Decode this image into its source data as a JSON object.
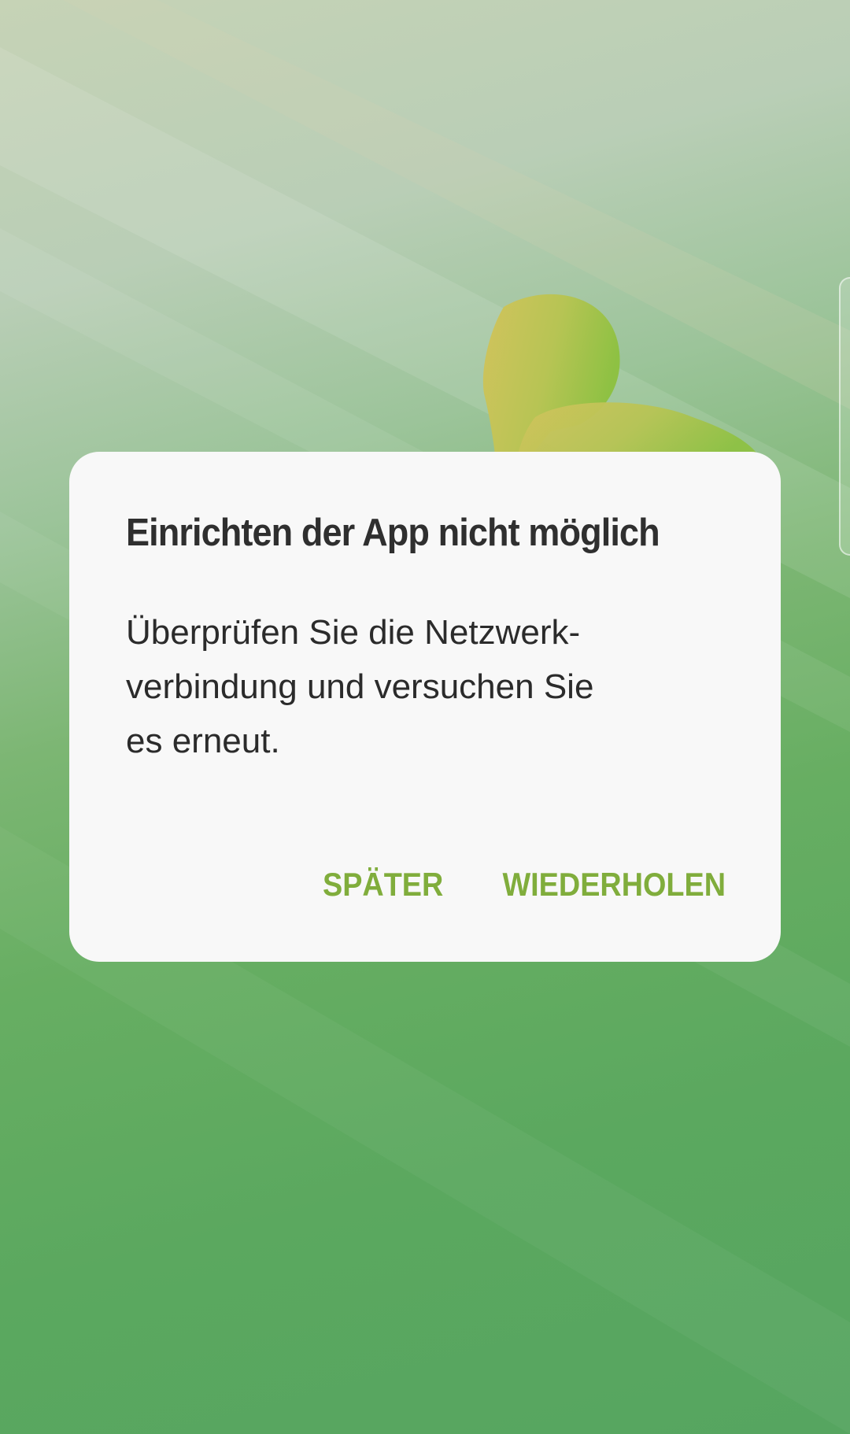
{
  "dialog": {
    "title": "Einrichten der App nicht möglich",
    "message_lines": [
      "Überprüfen Sie die Netzwerk-",
      "verbindung und versuchen Sie",
      "es erneut."
    ],
    "buttons": {
      "later": "SPÄTER",
      "retry": "WIEDERHOLEN"
    }
  },
  "colors": {
    "accent": "#80ad3c",
    "dialog_background": "#f8f8f8",
    "title_text": "#2f2f2f",
    "wallpaper_green": "#5ba85f"
  },
  "icons": {
    "background": "wallpaper-figure-illustration",
    "edge": "edge-panel-handle"
  }
}
